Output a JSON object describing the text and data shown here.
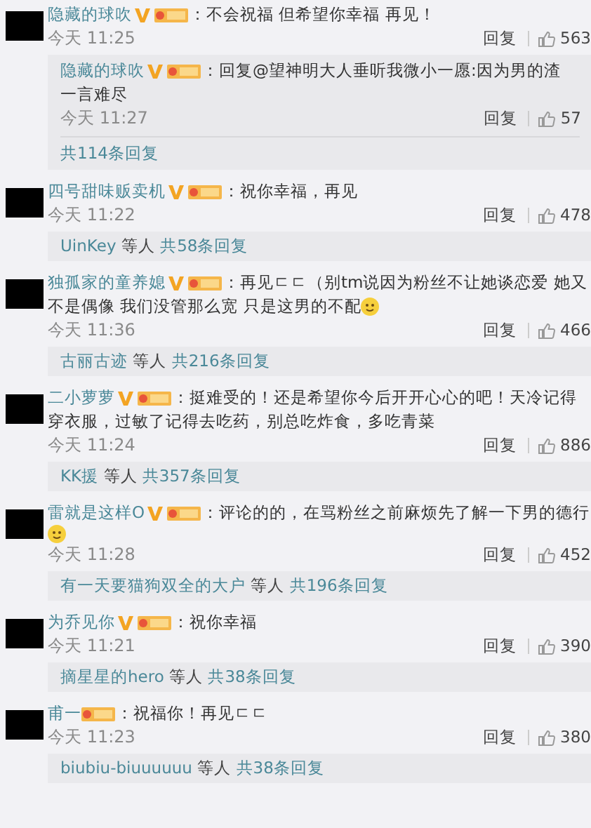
{
  "comments": [
    {
      "name": "隐藏的球吹",
      "verified": true,
      "lines": [
        "：不会祝福 但希望你幸福 再见！"
      ],
      "emoji": false,
      "time": "今天 11:25",
      "reply_label": "回复",
      "likes": "563",
      "sub_reply": {
        "name": "隐藏的球吹",
        "verified": true,
        "lines": [
          "：回复@望神明大人垂听我微小一愿:因为男的渣",
          "一言难尽"
        ],
        "time": "今天 11:27",
        "reply_label": "回复",
        "likes": "57"
      },
      "summary": {
        "total": "共114条回复"
      }
    },
    {
      "name": "四号甜味贩卖机",
      "verified": true,
      "lines": [
        "：祝你幸福，再见"
      ],
      "emoji": false,
      "time": "今天 11:22",
      "reply_label": "回复",
      "likes": "478",
      "summary": {
        "users": "UinKey",
        "others": "等人",
        "total": "共58条回复"
      }
    },
    {
      "name": "独孤家的童养媳",
      "verified": true,
      "lines": [
        "：再见ㄷㄷ（别tm说因为粉丝不让她谈恋爱 她又",
        "不是偶像 我们没管那么宽 只是这男的不配"
      ],
      "emoji": true,
      "time": "今天 11:36",
      "reply_label": "回复",
      "likes": "466",
      "summary": {
        "users": "古丽古迹",
        "others": "等人",
        "total": "共216条回复"
      }
    },
    {
      "name": "二小萝萝",
      "verified": true,
      "lines": [
        "：挺难受的！还是希望你今后开开心心的吧！天冷记得",
        "穿衣服，过敏了记得去吃药，别总吃炸食，多吃青菜"
      ],
      "emoji": false,
      "time": "今天 11:24",
      "reply_label": "回复",
      "likes": "886",
      "summary": {
        "users": "KK援",
        "others": "等人",
        "total": "共357条回复"
      }
    },
    {
      "name": "雷就是这样O",
      "verified": true,
      "lines": [
        "：评论的的，在骂粉丝之前麻烦先了解一下男的德行"
      ],
      "emoji": true,
      "time": "今天 11:28",
      "reply_label": "回复",
      "likes": "452",
      "summary": {
        "users": "有一天要猫狗双全的大户",
        "others": "等人",
        "total": "共196条回复"
      }
    },
    {
      "name": "为乔见你",
      "verified": true,
      "lines": [
        "：祝你幸福"
      ],
      "emoji": false,
      "time": "今天 11:21",
      "reply_label": "回复",
      "likes": "390",
      "summary": {
        "users": "摘星星的hero",
        "others": "等人",
        "total": "共38条回复"
      }
    },
    {
      "name": "甫一",
      "verified": false,
      "lines": [
        "：祝福你！再见ㄷㄷ"
      ],
      "emoji": false,
      "time": "今天 11:23",
      "reply_label": "回复",
      "likes": "380",
      "summary": {
        "users": "biubiu-biuuuuuu",
        "others": "等人",
        "total": "共38条回复"
      }
    }
  ]
}
